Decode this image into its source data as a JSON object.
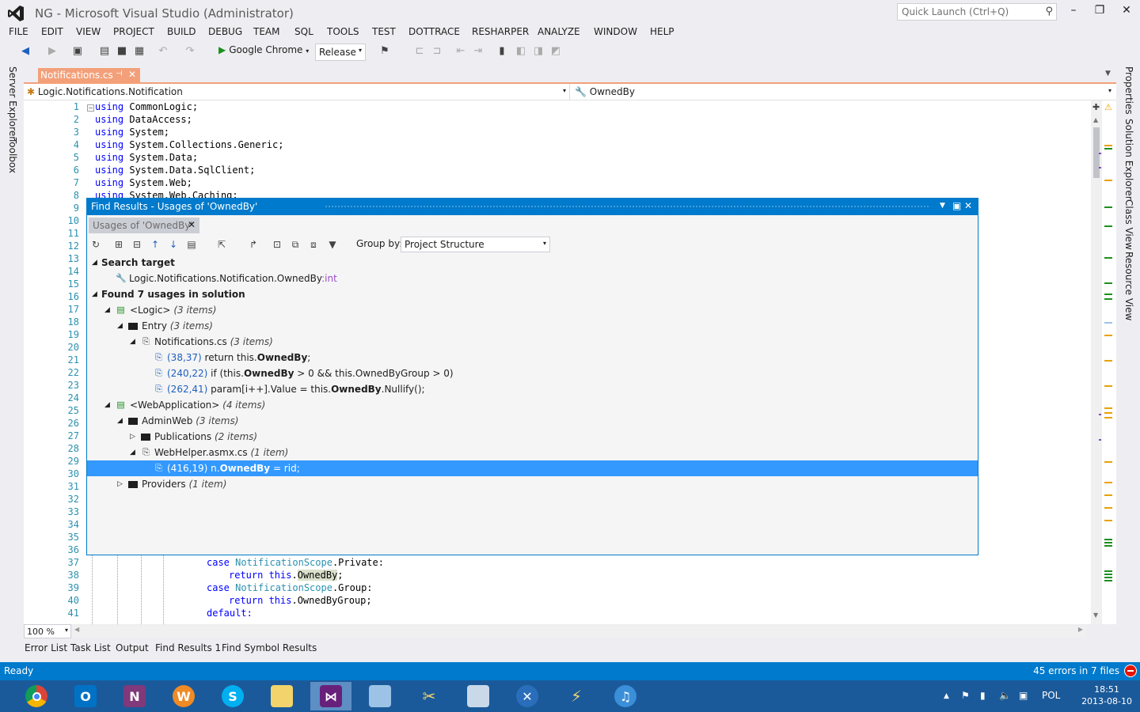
{
  "window": {
    "title": "NG - Microsoft Visual Studio (Administrator)",
    "quick_launch_placeholder": "Quick Launch (Ctrl+Q)"
  },
  "menu": [
    "FILE",
    "EDIT",
    "VIEW",
    "PROJECT",
    "BUILD",
    "DEBUG",
    "TEAM",
    "SQL",
    "TOOLS",
    "TEST",
    "DOTTRACE",
    "RESHARPER",
    "ANALYZE",
    "WINDOW",
    "HELP"
  ],
  "toolbar": {
    "run_target": "Google Chrome",
    "configuration": "Release"
  },
  "left_tabs": [
    "Server Explorer",
    "Toolbox"
  ],
  "right_tabs": [
    "Properties",
    "Solution Explorer",
    "Class View",
    "Resource View"
  ],
  "document": {
    "tab_label": "Notifications.cs",
    "nav_type": "Logic.Notifications.Notification",
    "nav_member": "OwnedBy"
  },
  "code_top": [
    "using CommonLogic;",
    "using DataAccess;",
    "using System;",
    "using System.Collections.Generic;",
    "using System.Data;",
    "using System.Data.SqlClient;",
    "using System.Web;",
    "using System.Web.Caching;"
  ],
  "code_bottom": {
    "l37": [
      "case ",
      "NotificationScope",
      ".Private:"
    ],
    "l38": [
      "return ",
      "this",
      ".",
      "OwnedBy",
      ";"
    ],
    "l39": [
      "case ",
      "NotificationScope",
      ".Group:"
    ],
    "l40": [
      "return ",
      "this",
      ".OwnedByGroup;"
    ],
    "l41": [
      "default:"
    ]
  },
  "find_results": {
    "title": "Find Results - Usages of 'OwnedBy'",
    "subtab": "Usages of 'OwnedBy'",
    "group_by_label": "Group by:",
    "group_by_value": "Project Structure",
    "search_target_header": "Search target",
    "target": "Logic.Notifications.Notification.OwnedBy",
    "target_type": ":int",
    "found_header": "Found 7 usages in solution",
    "logic_project": "<Logic>",
    "logic_count": "(3 items)",
    "entry_folder": "Entry",
    "entry_count": "(3 items)",
    "notifications_file": "Notifications.cs",
    "notifications_count": "(3 items)",
    "u1_pos": "(38,37)",
    "u1_pre": " return this.",
    "u1_bold": "OwnedBy",
    "u1_post": ";",
    "u2_pos": "(240,22)",
    "u2_pre": " if (this.",
    "u2_bold": "OwnedBy",
    "u2_post": " > 0 && this.OwnedByGroup > 0)",
    "u3_pos": "(262,41)",
    "u3_pre": " param[i++].Value = this.",
    "u3_bold": "OwnedBy",
    "u3_post": ".Nullify();",
    "web_project": "<WebApplication>",
    "web_count": "(4 items)",
    "adminweb_folder": "AdminWeb",
    "adminweb_count": "(3 items)",
    "publications_folder": "Publications",
    "publications_count": "(2 items)",
    "webhelper_file": "WebHelper.asmx.cs",
    "webhelper_count": "(1 item)",
    "u4_pos": "(416,19)",
    "u4_pre": " n.",
    "u4_bold": "OwnedBy",
    "u4_post": " = rid;",
    "providers_folder": "Providers",
    "providers_count": "(1 item)"
  },
  "zoom": "100 %",
  "bottom_tabs": [
    "Error List",
    "Task List",
    "Output",
    "Find Results 1",
    "Find Symbol Results"
  ],
  "status": {
    "left": "Ready",
    "right": "45 errors in 7 files"
  },
  "taskbar": {
    "language": "POL",
    "time": "18:51",
    "date": "2013-08-10"
  },
  "colors": {
    "accent": "#007acc",
    "doc_tab": "#f3a07a",
    "selection": "#3399ff"
  }
}
